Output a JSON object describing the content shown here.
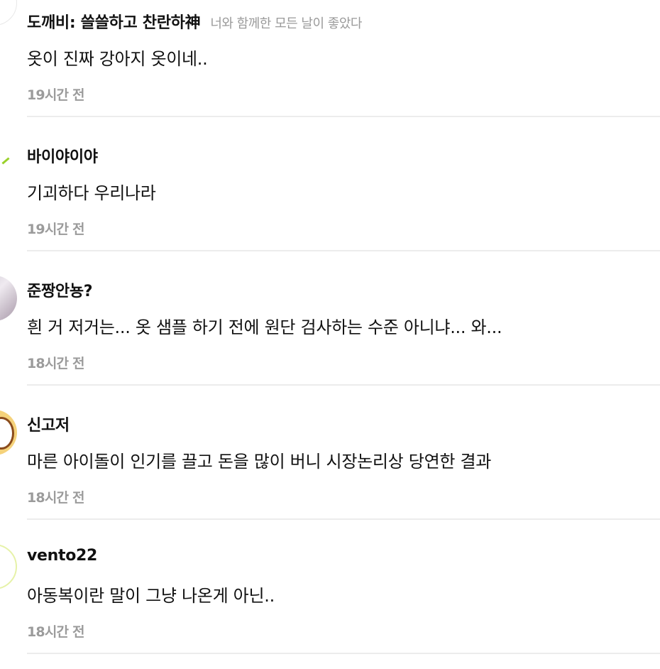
{
  "comments": [
    {
      "author": "도깨비: 쓸쓸하고 찬란하神",
      "author_note": "너와 함께한 모든 날이 좋았다",
      "text": "옷이 진짜 강아지 옷이네..",
      "time": "19시간 전"
    },
    {
      "author": "바이야이야",
      "author_note": "",
      "text": "기괴하다 우리나라",
      "time": "19시간 전"
    },
    {
      "author": "준짱안뇽?",
      "author_note": "",
      "text": "흰 거 저거는... 옷 샘플 하기 전에 원단 검사하는 수준 아니냐... 와...",
      "time": "18시간 전"
    },
    {
      "author": "신고저",
      "author_note": "",
      "text": "마른 아이돌이 인기를 끌고 돈을 많이 버니 시장논리상 당연한 결과",
      "time": "18시간 전"
    },
    {
      "author": "vento22",
      "author_note": "",
      "text": "아동복이란 말이 그냥 나온게 아닌..",
      "time": "18시간 전"
    }
  ]
}
